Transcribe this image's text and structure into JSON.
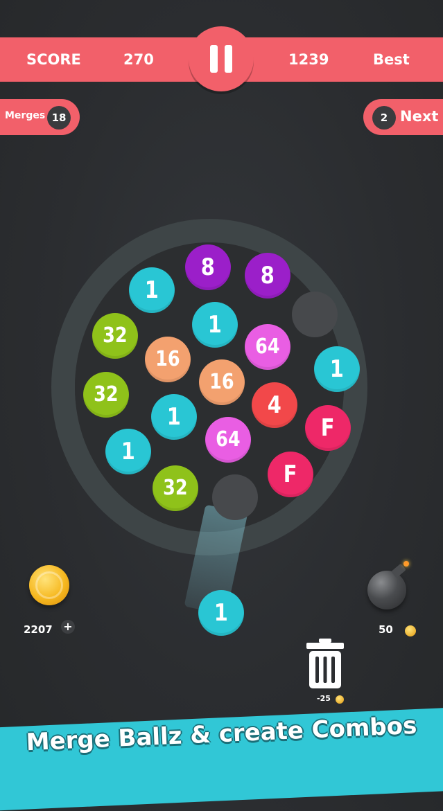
{
  "header": {
    "score_label": "SCORE",
    "score_value": "270",
    "best_value": "1239",
    "best_label": "Best"
  },
  "merges": {
    "label": "Merges",
    "count": "18"
  },
  "next": {
    "count": "2",
    "label": "Next"
  },
  "board": {
    "balls": [
      {
        "label": "8",
        "color": "#9b1fc9"
      },
      {
        "label": "8",
        "color": "#9b1fc9"
      },
      {
        "label": "1",
        "color": "#29c6d4"
      },
      {
        "label": "1",
        "color": "#29c6d4"
      },
      {
        "label": "32",
        "color": "#8fc21a"
      },
      {
        "label": "64",
        "color": "#e95ee3"
      },
      {
        "label": "16",
        "color": "#f3a16f"
      },
      {
        "label": "1",
        "color": "#29c6d4"
      },
      {
        "label": "16",
        "color": "#f3a16f"
      },
      {
        "label": "32",
        "color": "#8fc21a"
      },
      {
        "label": "4",
        "color": "#f2484a"
      },
      {
        "label": "1",
        "color": "#29c6d4"
      },
      {
        "label": "F",
        "color": "#ee2868"
      },
      {
        "label": "64",
        "color": "#e95ee3"
      },
      {
        "label": "1",
        "color": "#29c6d4"
      },
      {
        "label": "F",
        "color": "#ee2868"
      },
      {
        "label": "32",
        "color": "#8fc21a"
      }
    ],
    "shooter": {
      "label": "1",
      "color": "#29c6d4"
    }
  },
  "coins": {
    "amount": "2207",
    "plus_label": "+"
  },
  "bomb": {
    "cost": "50"
  },
  "trash": {
    "cost": "-25"
  },
  "banner": {
    "text": "Merge Ballz & create Combos"
  },
  "colors": {
    "accent": "#f2606a",
    "banner": "#31c7d6",
    "ring": "#3e4547"
  }
}
